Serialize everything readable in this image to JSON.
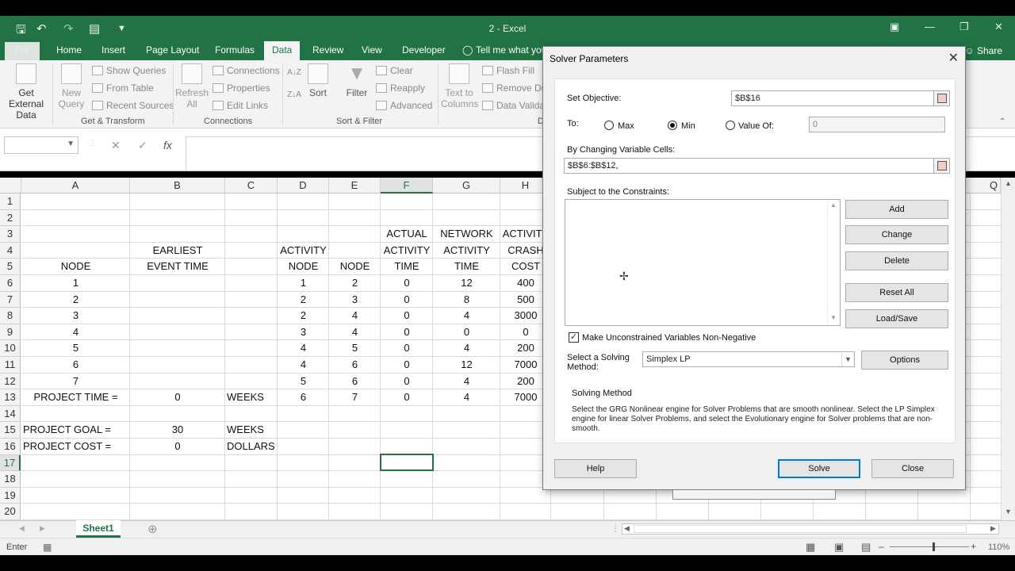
{
  "window": {
    "title": "2 - Excel"
  },
  "tabs": [
    "File",
    "Home",
    "Insert",
    "Page Layout",
    "Formulas",
    "Data",
    "Review",
    "View",
    "Developer",
    "Tell me what you"
  ],
  "share_label": "Share",
  "ribbon": {
    "get_external_data": [
      "Get External",
      "Data"
    ],
    "new_query": [
      "New",
      "Query"
    ],
    "show_queries": "Show Queries",
    "from_table": "From Table",
    "recent_sources": "Recent Sources",
    "group_get_transform": "Get & Transform",
    "refresh_all": [
      "Refresh",
      "All"
    ],
    "connections": "Connections",
    "properties": "Properties",
    "edit_links": "Edit Links",
    "group_connections": "Connections",
    "sort": "Sort",
    "filter": "Filter",
    "clear": "Clear",
    "reapply": "Reapply",
    "advanced": "Advanced",
    "group_sort_filter": "Sort & Filter",
    "text_to_columns": [
      "Text to",
      "Columns"
    ],
    "flash_fill": "Flash Fill",
    "remove_dup": "Remove Dup",
    "data_valid": "Data Validati",
    "group_data_tools_partial": "D"
  },
  "formula_bar": {
    "cancel": "✕",
    "enter": "✓",
    "fx": "fx"
  },
  "columns": [
    "A",
    "B",
    "C",
    "D",
    "E",
    "F",
    "G",
    "H",
    "Q"
  ],
  "rows": [
    "1",
    "2",
    "3",
    "4",
    "5",
    "6",
    "7",
    "8",
    "9",
    "10",
    "11",
    "12",
    "13",
    "14",
    "15",
    "16",
    "17",
    "18",
    "19",
    "20"
  ],
  "cells": {
    "F3": "ACTUAL",
    "G3": "NETWORK",
    "H3": "ACTIVITY",
    "B4": "EARLIEST",
    "D4": "ACTIVITY",
    "F4": "ACTIVITY",
    "G4": "ACTIVITY",
    "H4": "CRASH",
    "A5": "NODE",
    "B5": "EVENT TIME",
    "D5": "NODE",
    "E5": "NODE",
    "F5": "TIME",
    "G5": "TIME",
    "H5": "COST",
    "A6": "1",
    "D6": "1",
    "E6": "2",
    "F6": "0",
    "G6": "12",
    "H6": "400",
    "A7": "2",
    "D7": "2",
    "E7": "3",
    "F7": "0",
    "G7": "8",
    "H7": "500",
    "A8": "3",
    "D8": "2",
    "E8": "4",
    "F8": "0",
    "G8": "4",
    "H8": "3000",
    "A9": "4",
    "D9": "3",
    "E9": "4",
    "F9": "0",
    "G9": "0",
    "H9": "0",
    "A10": "5",
    "D10": "4",
    "E10": "5",
    "F10": "0",
    "G10": "4",
    "H10": "200",
    "A11": "6",
    "D11": "4",
    "E11": "6",
    "F11": "0",
    "G11": "12",
    "H11": "7000",
    "A12": "7",
    "D12": "5",
    "E12": "6",
    "F12": "0",
    "G12": "4",
    "H12": "200",
    "A13": "PROJECT TIME =",
    "B13": "0",
    "C13": "WEEKS",
    "D13": "6",
    "E13": "7",
    "F13": "0",
    "G13": "4",
    "H13": "7000",
    "A15": "PROJECT GOAL =",
    "B15": "30",
    "C15": "WEEKS",
    "A16": "PROJECT COST =",
    "B16": "0",
    "C16": "DOLLARS"
  },
  "sheet_tab": "Sheet1",
  "status": {
    "mode": "Enter",
    "zoom": "110%"
  },
  "dialog": {
    "title": "Solver Parameters",
    "set_objective_label": "Set Objective:",
    "objective_value": "$B$16",
    "to_label": "To:",
    "max_label": "Max",
    "min_label": "Min",
    "value_of_label": "Value Of:",
    "value_of_value": "0",
    "changing_cells_label": "By Changing Variable Cells:",
    "changing_cells_value": "$B$6:$B$12,",
    "constraints_label": "Subject to the Constraints:",
    "add": "Add",
    "change": "Change",
    "delete": "Delete",
    "reset_all": "Reset All",
    "load_save": "Load/Save",
    "nonneg_label": "Make Unconstrained Variables Non-Negative",
    "nonneg_checked": true,
    "method_label": [
      "Select a Solving",
      "Method:"
    ],
    "method_value": "Simplex LP",
    "options": "Options",
    "solving_method_title": "Solving Method",
    "solving_method_text": "Select the GRG Nonlinear engine for Solver Problems that are smooth nonlinear. Select the LP Simplex engine for linear Solver Problems, and select the Evolutionary engine for Solver problems that are non-smooth.",
    "help": "Help",
    "solve": "Solve",
    "close": "Close"
  },
  "colors": {
    "excel_green": "#217346",
    "accent_blue": "#0078d7"
  }
}
